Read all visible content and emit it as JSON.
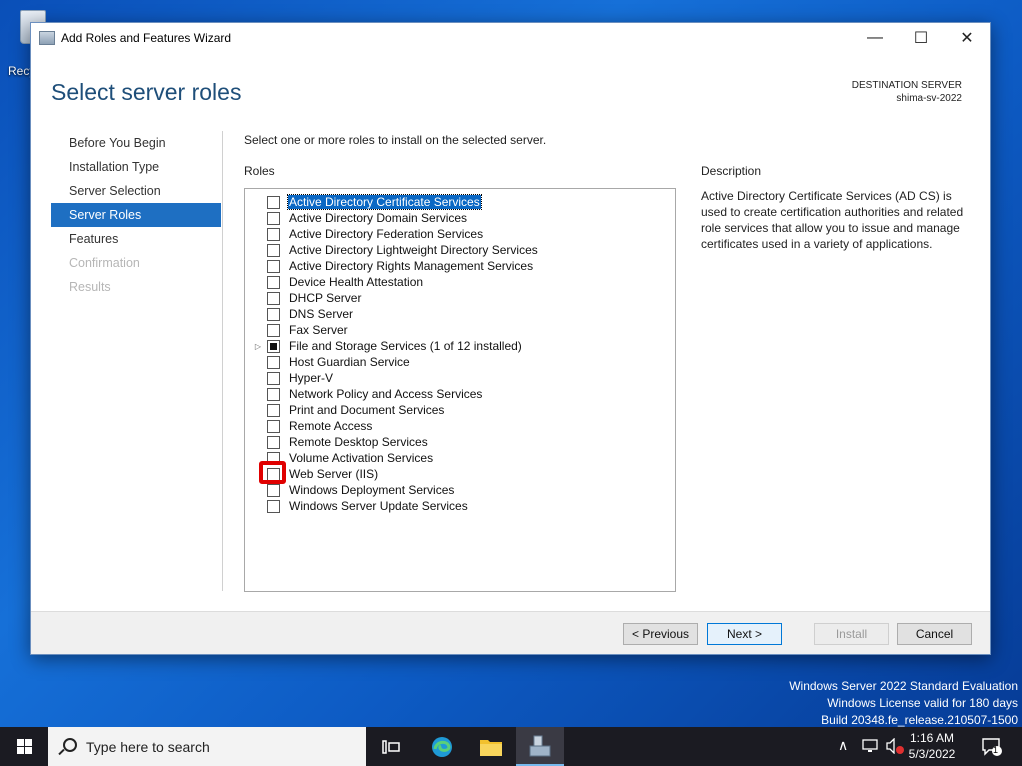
{
  "desktop": {
    "recycle_bin_label": "Recy"
  },
  "window": {
    "title": "Add Roles and Features Wizard",
    "min_glyph": "—",
    "max_glyph": "☐",
    "close_glyph": "✕",
    "page_title": "Select server roles",
    "destination_label": "DESTINATION SERVER",
    "destination_server": "shima-sv-2022"
  },
  "nav": [
    {
      "label": "Before You Begin",
      "state": "normal"
    },
    {
      "label": "Installation Type",
      "state": "normal"
    },
    {
      "label": "Server Selection",
      "state": "normal"
    },
    {
      "label": "Server Roles",
      "state": "active"
    },
    {
      "label": "Features",
      "state": "normal"
    },
    {
      "label": "Confirmation",
      "state": "disabled"
    },
    {
      "label": "Results",
      "state": "disabled"
    }
  ],
  "main": {
    "intro": "Select one or more roles to install on the selected server.",
    "roles_heading": "Roles",
    "roles": [
      {
        "label": "Active Directory Certificate Services",
        "checked": "none",
        "selected": true,
        "expandable": false
      },
      {
        "label": "Active Directory Domain Services",
        "checked": "none",
        "selected": false,
        "expandable": false
      },
      {
        "label": "Active Directory Federation Services",
        "checked": "none",
        "selected": false,
        "expandable": false
      },
      {
        "label": "Active Directory Lightweight Directory Services",
        "checked": "none",
        "selected": false,
        "expandable": false
      },
      {
        "label": "Active Directory Rights Management Services",
        "checked": "none",
        "selected": false,
        "expandable": false
      },
      {
        "label": "Device Health Attestation",
        "checked": "none",
        "selected": false,
        "expandable": false
      },
      {
        "label": "DHCP Server",
        "checked": "none",
        "selected": false,
        "expandable": false
      },
      {
        "label": "DNS Server",
        "checked": "none",
        "selected": false,
        "expandable": false
      },
      {
        "label": "Fax Server",
        "checked": "none",
        "selected": false,
        "expandable": false
      },
      {
        "label": "File and Storage Services (1 of 12 installed)",
        "checked": "partial",
        "selected": false,
        "expandable": true
      },
      {
        "label": "Host Guardian Service",
        "checked": "none",
        "selected": false,
        "expandable": false
      },
      {
        "label": "Hyper-V",
        "checked": "none",
        "selected": false,
        "expandable": false
      },
      {
        "label": "Network Policy and Access Services",
        "checked": "none",
        "selected": false,
        "expandable": false
      },
      {
        "label": "Print and Document Services",
        "checked": "none",
        "selected": false,
        "expandable": false
      },
      {
        "label": "Remote Access",
        "checked": "none",
        "selected": false,
        "expandable": false
      },
      {
        "label": "Remote Desktop Services",
        "checked": "none",
        "selected": false,
        "expandable": false
      },
      {
        "label": "Volume Activation Services",
        "checked": "none",
        "selected": false,
        "expandable": false
      },
      {
        "label": "Web Server (IIS)",
        "checked": "none",
        "selected": false,
        "expandable": false
      },
      {
        "label": "Windows Deployment Services",
        "checked": "none",
        "selected": false,
        "expandable": false
      },
      {
        "label": "Windows Server Update Services",
        "checked": "none",
        "selected": false,
        "expandable": false
      }
    ],
    "description_heading": "Description",
    "description_text": "Active Directory Certificate Services (AD CS) is used to create certification authorities and related role services that allow you to issue and manage certificates used in a variety of applications."
  },
  "footer": {
    "previous": "< Previous",
    "next": "Next >",
    "install": "Install",
    "cancel": "Cancel"
  },
  "watermark": {
    "line1": "Windows Server 2022 Standard Evaluation",
    "line2": "Windows License valid for 180 days",
    "line3": "Build 20348.fe_release.210507-1500"
  },
  "taskbar": {
    "search_placeholder": "Type here to search",
    "time": "1:16 AM",
    "date": "5/3/2022",
    "notification_count": "1"
  }
}
